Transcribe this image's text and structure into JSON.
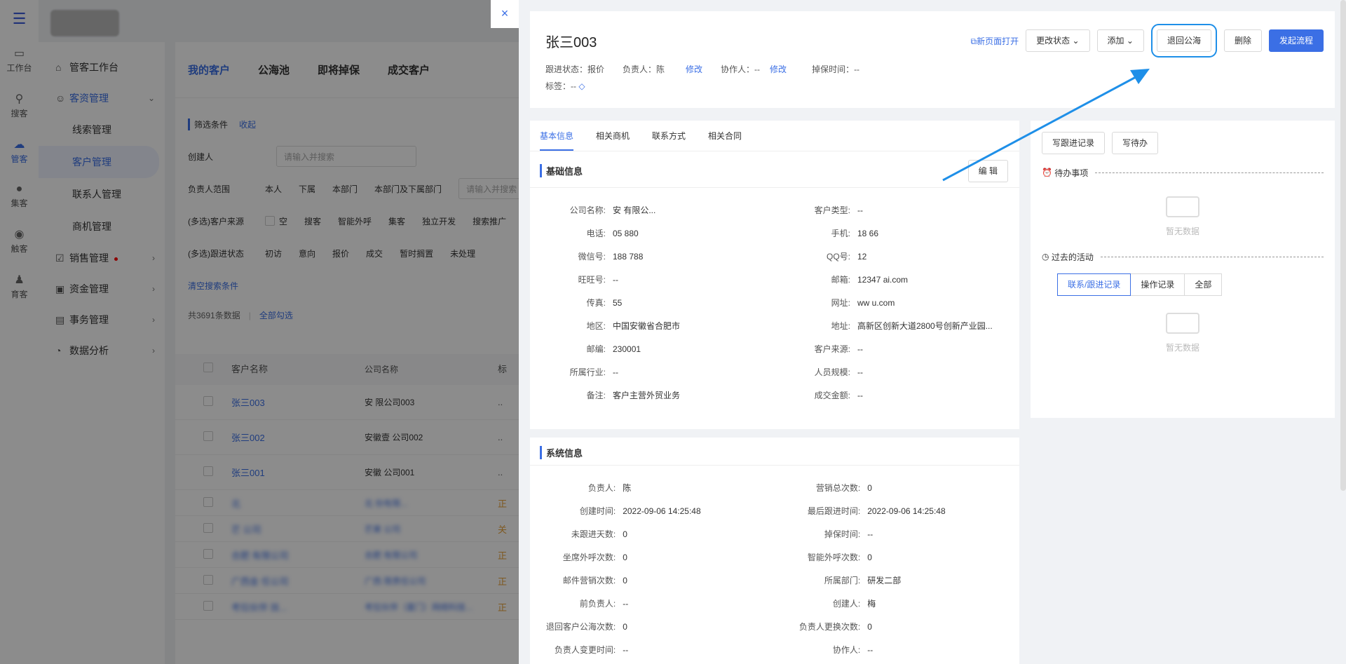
{
  "rail": [
    "工作台",
    "搜客",
    "管客",
    "集客",
    "触客",
    "育客"
  ],
  "sidebar": {
    "workbench": "管客工作台",
    "group": "客资管理",
    "subs": [
      "线索管理",
      "客户管理",
      "联系人管理",
      "商机管理"
    ],
    "groups": [
      "销售管理",
      "资金管理",
      "事务管理",
      "数据分析"
    ]
  },
  "tabs": [
    "我的客户",
    "公海池",
    "即将掉保",
    "成交客户"
  ],
  "filter": {
    "title": "筛选条件",
    "collapse": "收起",
    "creator": "创建人",
    "creator_ph": "请输入并搜索",
    "owner_scope": "负责人范围",
    "scopes": [
      "本人",
      "下属",
      "本部门",
      "本部门及下属部门"
    ],
    "scope_ph": "请输入并搜索",
    "source_lbl": "(多选)客户来源",
    "sources": [
      "空",
      "搜客",
      "智能外呼",
      "集客",
      "独立开发",
      "搜索推广"
    ],
    "status_lbl": "(多选)跟进状态",
    "statuses": [
      "初访",
      "意向",
      "报价",
      "成交",
      "暂时搁置",
      "未处理"
    ],
    "clear": "清空搜索条件"
  },
  "list": {
    "count": "共3691条数据",
    "select_all": "全部勾选",
    "cols": [
      "客户名称",
      "公司名称",
      "标"
    ],
    "rows": [
      [
        "张三003",
        "安 限公司003",
        ".."
      ],
      [
        "张三002",
        "安徽壹 公司002",
        ".."
      ],
      [
        "张三001",
        "安徽 公司001",
        ".."
      ],
      [
        "北 ",
        "北 份有限...",
        "正"
      ],
      [
        "芒 公司",
        "芒果 公司",
        "关"
      ],
      [
        "合肥 有限公司",
        "合肥 有限公司",
        "正"
      ],
      [
        "广西金 任公司",
        "广西 限责任公司",
        "正"
      ],
      [
        "考拉伙伴 技...",
        "考拉伙伴（厦门）网络科技...",
        "正"
      ]
    ]
  },
  "drawer": {
    "close": "×",
    "title": "张三003",
    "follow_status": "跟进状态：报价",
    "owner": "负责人：陈",
    "edit": "修改",
    "collab": "协作人：--",
    "protect": "掉保时间：--",
    "tags": "标签：--",
    "open_new": "新页面打开",
    "change_status": "更改状态",
    "add": "添加",
    "return_pool": "退回公海",
    "delete": "删除",
    "start_flow": "发起流程"
  },
  "detail_tabs": [
    "基本信息",
    "相关商机",
    "联系方式",
    "相关合同"
  ],
  "basic": {
    "title": "基础信息",
    "edit": "编 辑",
    "fields": [
      [
        "公司名称:",
        "安 有限公..."
      ],
      [
        "客户类型:",
        "--"
      ],
      [
        "电话:",
        "05 880"
      ],
      [
        "手机:",
        "18 66"
      ],
      [
        "微信号:",
        "188 788"
      ],
      [
        "QQ号:",
        "12"
      ],
      [
        "旺旺号:",
        "--"
      ],
      [
        "邮箱:",
        "12347 ai.com"
      ],
      [
        "传真:",
        "55"
      ],
      [
        "网址:",
        "ww u.com"
      ],
      [
        "地区:",
        "中国安徽省合肥市"
      ],
      [
        "地址:",
        "高新区创新大道2800号创新产业园..."
      ],
      [
        "邮编:",
        "230001"
      ],
      [
        "客户来源:",
        "--"
      ],
      [
        "所属行业:",
        "--"
      ],
      [
        "人员规模:",
        "--"
      ],
      [
        "备注:",
        "客户主营外贸业务"
      ],
      [
        "成交金额:",
        "--"
      ]
    ]
  },
  "system": {
    "title": "系统信息",
    "fields": [
      [
        "负责人:",
        "陈"
      ],
      [
        "营销总次数:",
        "0"
      ],
      [
        "创建时间:",
        "2022-09-06 14:25:48"
      ],
      [
        "最后跟进时间:",
        "2022-09-06 14:25:48"
      ],
      [
        "未跟进天数:",
        "0"
      ],
      [
        "掉保时间:",
        "--"
      ],
      [
        "坐席外呼次数:",
        "0"
      ],
      [
        "智能外呼次数:",
        "0"
      ],
      [
        "邮件营销次数:",
        "0"
      ],
      [
        "所属部门:",
        "研发二部"
      ],
      [
        "前负责人:",
        "--"
      ],
      [
        "创建人:",
        "梅"
      ],
      [
        "退回客户公海次数:",
        "0"
      ],
      [
        "负责人更换次数:",
        "0"
      ],
      [
        "负责人变更时间:",
        "--"
      ],
      [
        "协作人:",
        "--"
      ]
    ]
  },
  "right": {
    "write_follow": "写跟进记录",
    "write_todo": "写待办",
    "todo": "待办事项",
    "no_data": "暂无数据",
    "past": "过去的活动",
    "segs": [
      "联系/跟进记录",
      "操作记录",
      "全部"
    ]
  }
}
